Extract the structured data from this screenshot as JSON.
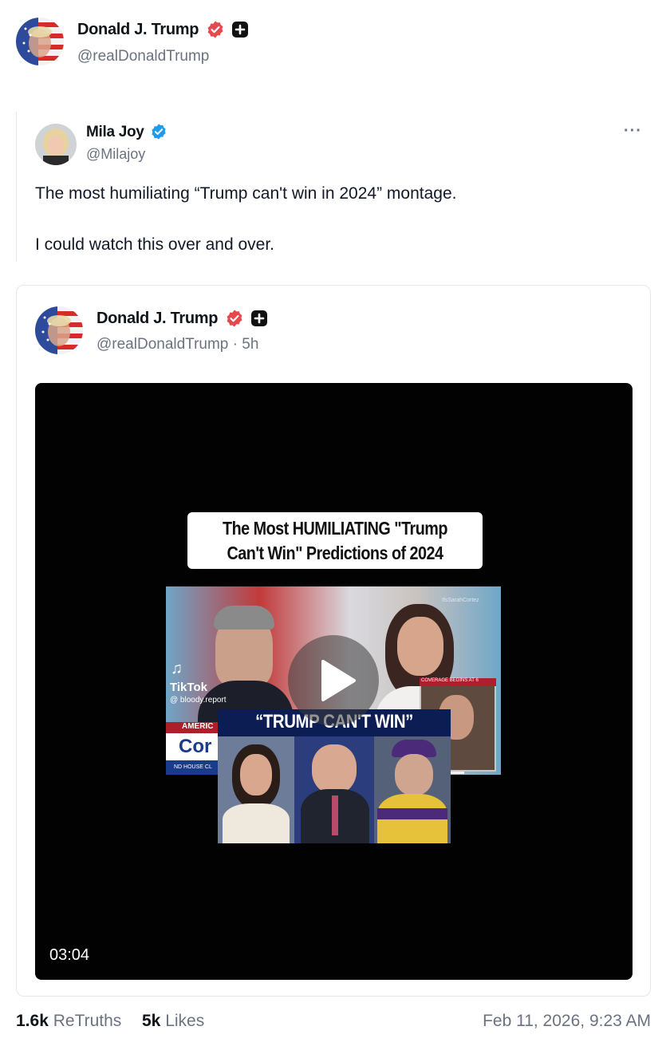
{
  "outer_post": {
    "author_name": "Donald J. Trump",
    "author_handle": "@realDonaldTrump"
  },
  "quoted_post": {
    "author_name": "Mila Joy",
    "author_handle": "@Milajoy",
    "more_label": "···",
    "line1": "The most humiliating “Trump can't win in 2024” montage.",
    "line2": "I could watch this over and over."
  },
  "embedded_post": {
    "author_name": "Donald J. Trump",
    "author_handle": "@realDonaldTrump · 5h",
    "video": {
      "title_line1": "The Most HUMILIATING \"Trump",
      "title_line2": "Can't Win\" Predictions of 2024",
      "duration": "03:04",
      "tiktok_label": "TikTok",
      "tiktok_handle": "@ bloody.report",
      "banner": "“TRUMP CAN'T WIN”",
      "lower_third": "AMERIC",
      "lower_third_big": "Cor",
      "coverage": "COVERAGE BEGINS AT 6",
      "watermark": "IfsSarahCortez",
      "house": "ND HOUSE CL"
    }
  },
  "stats": {
    "retruths_count": "1.6k",
    "retruths_label": "ReTruths",
    "likes_count": "5k",
    "likes_label": "Likes",
    "timestamp": "Feb 11, 2026, 9:23 AM"
  },
  "colors": {
    "verified_red": "#e5484d",
    "verified_blue": "#1d9bf0",
    "muted_text": "#6b7280"
  }
}
